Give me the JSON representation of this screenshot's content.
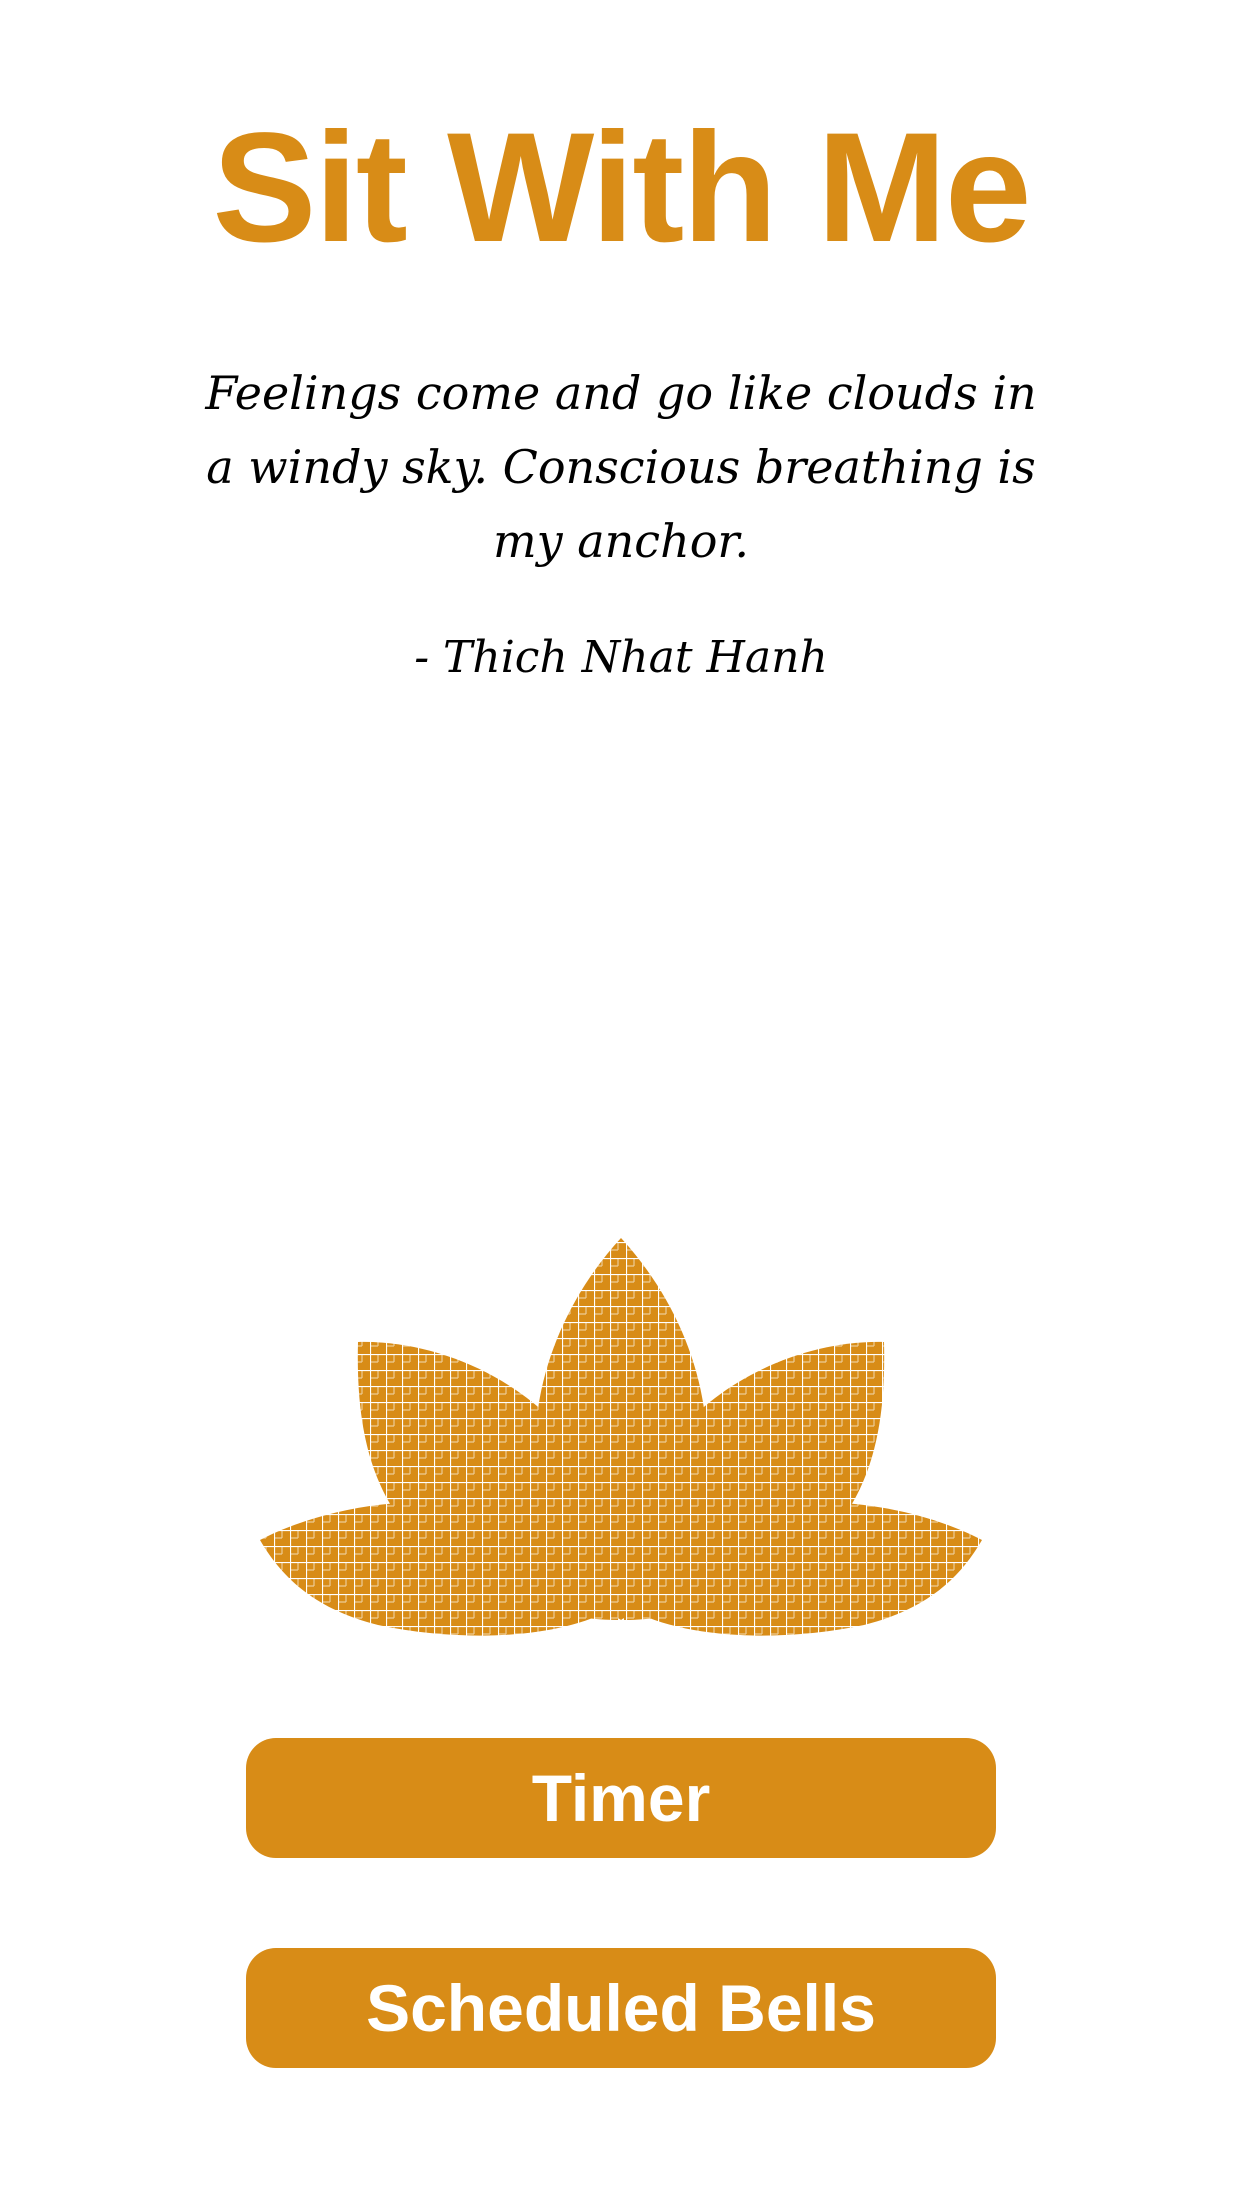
{
  "header": {
    "title": "Sit With Me"
  },
  "quote": {
    "text": "Feelings come and go like clouds in a windy sky. Conscious breathing is my anchor.",
    "attribution": "- Thich Nhat Hanh"
  },
  "logo": {
    "icon": "lotus-icon"
  },
  "actions": {
    "timer_label": "Timer",
    "bells_label": "Scheduled Bells"
  },
  "colors": {
    "accent": "#D88C17",
    "background": "#FFFFFF",
    "text": "#000000",
    "button_text": "#FFFFFF"
  }
}
